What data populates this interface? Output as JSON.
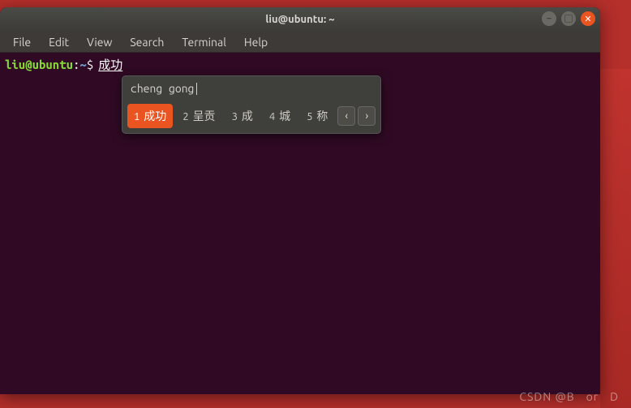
{
  "window": {
    "title": "liu@ubuntu: ~"
  },
  "menu": {
    "file": "File",
    "edit": "Edit",
    "view": "View",
    "search": "Search",
    "terminal": "Terminal",
    "help": "Help"
  },
  "prompt": {
    "user_host": "liu@ubuntu",
    "colon": ":",
    "path": "~",
    "symbol": "$",
    "preedit": "成功"
  },
  "ime": {
    "input": "cheng gong",
    "candidates": [
      {
        "n": "1",
        "text": "成功"
      },
      {
        "n": "2",
        "text": "呈贡"
      },
      {
        "n": "3",
        "text": "成"
      },
      {
        "n": "4",
        "text": "城"
      },
      {
        "n": "5",
        "text": "称"
      }
    ]
  },
  "watermark": {
    "left": "CSDN @B",
    "mid": "or",
    "right": "D"
  },
  "controls": {
    "min_glyph": "–",
    "max_glyph": "□",
    "close_glyph": "✕",
    "prev_glyph": "‹",
    "next_glyph": "›"
  }
}
